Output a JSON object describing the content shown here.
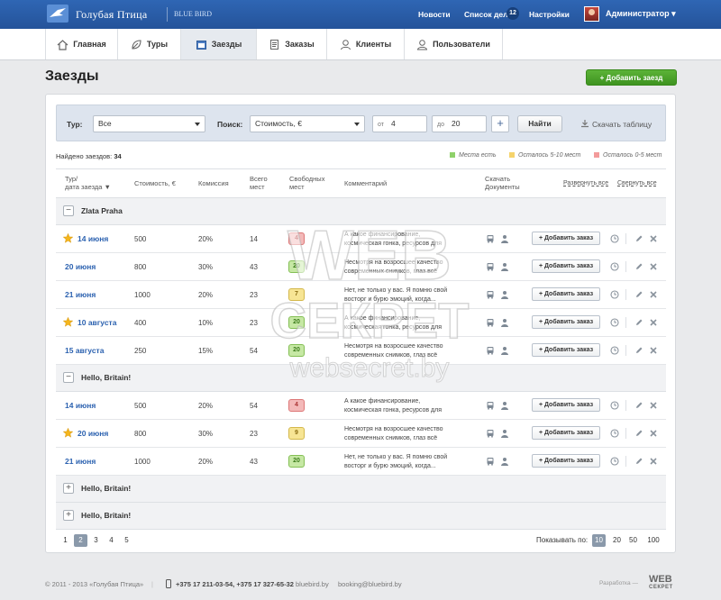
{
  "brand": {
    "name_ru": "Голубая Птица",
    "name_en": "BLUE BIRD"
  },
  "topnav": {
    "news": "Новости",
    "todo": "Список дел",
    "todo_count": "12",
    "settings": "Настройки",
    "user": "Администратор ▾"
  },
  "nav": {
    "items": [
      {
        "label": "Главная",
        "icon": "home-icon"
      },
      {
        "label": "Туры",
        "icon": "tours-icon"
      },
      {
        "label": "Заезды",
        "icon": "calendar-icon"
      },
      {
        "label": "Заказы",
        "icon": "orders-icon"
      },
      {
        "label": "Клиенты",
        "icon": "user-icon"
      },
      {
        "label": "Пользователи",
        "icon": "users-icon"
      }
    ],
    "active_index": 2
  },
  "page": {
    "title": "Заезды",
    "add_button": "+ Добавить заезд"
  },
  "filter": {
    "tour_label": "Тур:",
    "tour_value": "Все",
    "search_label": "Поиск:",
    "search_value": "Стоимость, €",
    "from_prefix": "от",
    "from_value": "4",
    "to_prefix": "до",
    "to_value": "20",
    "plus": "+",
    "find_button": "Найти",
    "download": "Скачать таблицу"
  },
  "summary": {
    "found_label": "Найдено заездов:",
    "found_count": "34"
  },
  "legend": {
    "green": "Места есть",
    "yellow": "Осталось 5-10 мест",
    "red": "Осталось 0-5 мест",
    "colors": {
      "green": "#8fd16a",
      "yellow": "#f5d36b",
      "red": "#f39b9b"
    }
  },
  "table": {
    "headers": {
      "tour_date_1": "Тур/",
      "tour_date_2": "дата заезда ▼",
      "cost": "Стоимость, €",
      "commission": "Комиссия",
      "total_1": "Всего",
      "total_2": "мест",
      "free_1": "Свободных",
      "free_2": "мест",
      "comment": "Комментарий",
      "docs_1": "Скачать",
      "docs_2": "Документы",
      "expand_all": "Развернуть все",
      "collapse_all": "Свернуть все"
    },
    "add_order": "+ Добавить заказ",
    "groups": [
      {
        "name": "Zlata Praha",
        "toggle": "−",
        "rows": [
          {
            "date": "14 июня",
            "starred": true,
            "cost": "500",
            "commission": "20%",
            "total": "14",
            "free": "4",
            "level": "red",
            "comment": [
              "А какое финансирование,",
              "космическая гонка, ресурсов для"
            ]
          },
          {
            "date": "20 июня",
            "starred": false,
            "cost": "800",
            "commission": "30%",
            "total": "43",
            "free": "20",
            "level": "green",
            "comment": [
              "Несмотря на возросшее качество",
              "современных снимков, глаз всё"
            ]
          },
          {
            "date": "21 июня",
            "starred": false,
            "cost": "1000",
            "commission": "20%",
            "total": "23",
            "free": "7",
            "level": "yellow",
            "comment": [
              "Нет, не только у вас. Я помню свой",
              "восторг и бурю эмоций, когда..."
            ]
          },
          {
            "date": "10 августа",
            "starred": true,
            "cost": "400",
            "commission": "10%",
            "total": "23",
            "free": "20",
            "level": "green",
            "comment": [
              "А какое финансирование,",
              "космическая гонка, ресурсов для"
            ]
          },
          {
            "date": "15 августа",
            "starred": false,
            "cost": "250",
            "commission": "15%",
            "total": "54",
            "free": "20",
            "level": "green",
            "comment": [
              "Несмотря на возросшее качество",
              "современных снимков, глаз всё"
            ]
          }
        ]
      },
      {
        "name": "Hello, Britain!",
        "toggle": "−",
        "rows": [
          {
            "date": "14 июня",
            "starred": false,
            "cost": "500",
            "commission": "20%",
            "total": "54",
            "free": "4",
            "level": "red",
            "comment": [
              "А какое финансирование,",
              "космическая гонка, ресурсов для"
            ]
          },
          {
            "date": "20 июня",
            "starred": true,
            "cost": "800",
            "commission": "30%",
            "total": "23",
            "free": "9",
            "level": "yellow",
            "comment": [
              "Несмотря на возросшее качество",
              "современных снимков, глаз всё"
            ]
          },
          {
            "date": "21 июня",
            "starred": false,
            "cost": "1000",
            "commission": "20%",
            "total": "43",
            "free": "20",
            "level": "green",
            "comment": [
              "Нет, не только у вас. Я помню свой",
              "восторг и бурю эмоций, когда..."
            ]
          }
        ]
      },
      {
        "name": "Hello, Britain!",
        "toggle": "+",
        "rows": []
      },
      {
        "name": "Hello, Britain!",
        "toggle": "+",
        "rows": []
      }
    ]
  },
  "pagination": {
    "pages": [
      "1",
      "2",
      "3",
      "4",
      "5"
    ],
    "active_page": "2",
    "show_label": "Показывать по:",
    "sizes": [
      "10",
      "20",
      "50",
      "100"
    ],
    "active_size": "10"
  },
  "footer": {
    "copyright": "© 2011 - 2013 «Голубая Птица»",
    "phones": "+375 17 211-03-54, +375 17 327-65-32",
    "site": "bluebird.by",
    "email": "booking@bluebird.by",
    "dev_label": "Разработка —",
    "dev_logo_1": "WEB",
    "dev_logo_2": "СЕКРЕТ"
  },
  "watermark": {
    "line1": "WEB",
    "line2": "СЕКРЕТ",
    "line3": "websecret.by"
  }
}
